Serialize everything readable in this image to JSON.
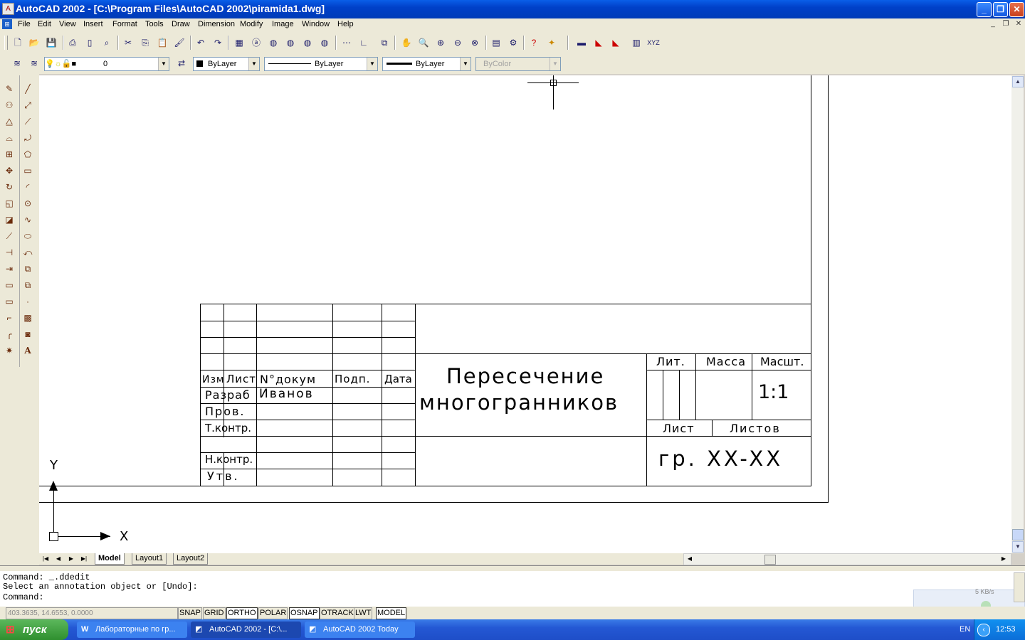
{
  "window": {
    "title": "AutoCAD 2002 - [C:\\Program Files\\AutoCAD 2002\\piramida1.dwg]",
    "min": "_",
    "max": "❐",
    "close": "✕"
  },
  "menu": [
    "File",
    "Edit",
    "View",
    "Insert",
    "Format",
    "Tools",
    "Draw",
    "Dimension",
    "Modify",
    "Image",
    "Window",
    "Help"
  ],
  "properties": {
    "layer": "0",
    "color": "ByLayer",
    "linetype": "ByLayer",
    "lineweight": "ByLayer",
    "plotstyle": "ByColor"
  },
  "titleblock": {
    "title_line1": "Пересечение",
    "title_line2": "многогранников",
    "col_headers": [
      "Изм",
      "Лист",
      "N°докум",
      "Подп.",
      "Дата"
    ],
    "rows": [
      "Разраб",
      "Пров.",
      "Т.контр.",
      "",
      "Н.контр.",
      "Утв."
    ],
    "developer": "Иванов",
    "lit": "Лит.",
    "mass": "Масса",
    "scale_label": "Масшт.",
    "scale_value": "1:1",
    "sheet": "Лист",
    "sheets": "Листов",
    "group": "гр. XX-XX"
  },
  "ucs": {
    "x": "X",
    "y": "Y"
  },
  "tabs": [
    "Model",
    "Layout1",
    "Layout2"
  ],
  "command": {
    "line1": "Command: _.ddedit",
    "line2": "Select an annotation object or [Undo]:",
    "line3": "Command:"
  },
  "status": {
    "coords": "403.3635, 14.6553, 0.0000",
    "buttons": [
      "SNAP",
      "GRID",
      "ORTHO",
      "POLAR",
      "OSNAP",
      "OTRACK",
      "LWT",
      "MODEL"
    ],
    "net": "5 KB/s"
  },
  "taskbar": {
    "start": "пуск",
    "tasks": [
      "Лабораторные по гр...",
      "AutoCAD 2002 - [C:\\...",
      "AutoCAD 2002 Today"
    ],
    "lang": "EN",
    "time": "12:53"
  }
}
